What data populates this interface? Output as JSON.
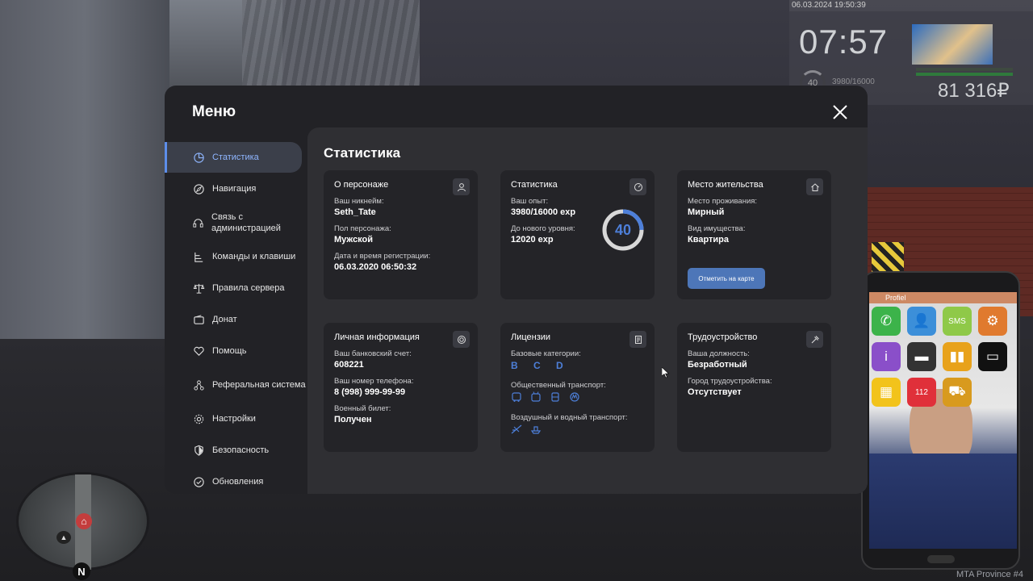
{
  "hud": {
    "datetime": "06.03.2024 19:50:39",
    "time": "07:57",
    "level": "40",
    "exp": "3980/16000",
    "money": "81 316₽"
  },
  "map": {
    "north": "N"
  },
  "phone": {
    "carrier": "Profiel",
    "apps": [
      {
        "icon": "phone-icon",
        "color": "#3cb34a",
        "glyph": "✆"
      },
      {
        "icon": "contacts-icon",
        "color": "#3c8fd9",
        "glyph": "👤"
      },
      {
        "icon": "sms-icon",
        "color": "#8fc948",
        "glyph": "SMS"
      },
      {
        "icon": "settings-icon",
        "color": "#e07a2e",
        "glyph": "⚙"
      },
      {
        "icon": "info-icon",
        "color": "#8a4fc9",
        "glyph": "i"
      },
      {
        "icon": "card-icon",
        "color": "#333333",
        "glyph": "▬"
      },
      {
        "icon": "stats-icon",
        "color": "#e8a21b",
        "glyph": "▮▮"
      },
      {
        "icon": "bed-icon",
        "color": "#111111",
        "glyph": "▭"
      },
      {
        "icon": "taxi-icon",
        "color": "#f2c31b",
        "glyph": "▦"
      },
      {
        "icon": "emergency-112-icon",
        "color": "#e0303a",
        "glyph": "112"
      },
      {
        "icon": "tow-truck-icon",
        "color": "#d89a1e",
        "glyph": "⛟"
      }
    ]
  },
  "watermark": "MTA Province #4",
  "menu": {
    "title": "Меню",
    "sidebar": [
      {
        "label": "Статистика",
        "icon": "pie-chart-icon",
        "active": true
      },
      {
        "label": "Навигация",
        "icon": "compass-icon"
      },
      {
        "label": "Связь с администрацией",
        "icon": "headset-icon"
      },
      {
        "label": "Команды и клавиши",
        "icon": "keys-icon"
      },
      {
        "label": "Правила сервера",
        "icon": "scales-icon"
      },
      {
        "label": "Донат",
        "icon": "wallet-icon"
      },
      {
        "label": "Помощь",
        "icon": "help-heart-icon"
      },
      {
        "label": "Реферальная система",
        "icon": "referral-icon"
      },
      {
        "label": "Настройки",
        "icon": "gear-icon"
      },
      {
        "label": "Безопасность",
        "icon": "shield-icon"
      },
      {
        "label": "Обновления",
        "icon": "check-circle-icon"
      }
    ],
    "content_title": "Статистика",
    "cards": {
      "character": {
        "title": "О персонаже",
        "nickname_label": "Ваш никнейм:",
        "nickname": "Seth_Tate",
        "gender_label": "Пол персонажа:",
        "gender": "Мужской",
        "reg_label": "Дата и время регистрации:",
        "reg": "06.03.2020 06:50:32"
      },
      "stats": {
        "title": "Статистика",
        "exp_label": "Ваш опыт:",
        "exp": "3980/16000 exp",
        "next_label": "До нового уровня:",
        "next": "12020 exp",
        "level": "40",
        "level_progress": 0.249
      },
      "residence": {
        "title": "Место жительства",
        "place_label": "Место проживания:",
        "place": "Мирный",
        "property_label": "Вид имущества:",
        "property": "Квартира",
        "map_button": "Отметить на карте"
      },
      "personal": {
        "title": "Личная информация",
        "bank_label": "Ваш банковский счет:",
        "bank": "608221",
        "phone_label": "Ваш номер телефона:",
        "phone": "8 (998) 999-99-99",
        "military_label": "Военный билет:",
        "military": "Получен"
      },
      "licenses": {
        "title": "Лицензии",
        "base_label": "Базовые категории:",
        "base": "B C D",
        "public_label": "Общественный транспорт:",
        "air_label": "Воздушный и водный транспорт:"
      },
      "employment": {
        "title": "Трудоустройство",
        "position_label": "Ваша должность:",
        "position": "Безработный",
        "city_label": "Город трудоустройства:",
        "city": "Отсутствует"
      }
    }
  }
}
